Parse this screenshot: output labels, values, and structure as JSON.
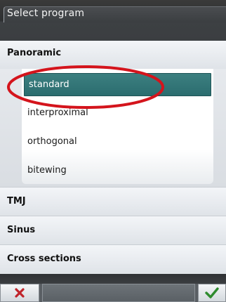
{
  "window": {
    "title": "Select program"
  },
  "groups": [
    {
      "label": "Panoramic",
      "expanded": true
    },
    {
      "label": "TMJ",
      "expanded": false
    },
    {
      "label": "Sinus",
      "expanded": false
    },
    {
      "label": "Cross sections",
      "expanded": false
    }
  ],
  "panoramic_programs": [
    {
      "label": "standard",
      "selected": true
    },
    {
      "label": "interproximal",
      "selected": false
    },
    {
      "label": "orthogonal",
      "selected": false
    },
    {
      "label": "bitewing",
      "selected": false
    }
  ],
  "footer": {
    "cancel_icon": "close-icon",
    "ok_icon": "checkmark-icon",
    "cancel_color": "#c0242b",
    "ok_color": "#2e8b2e"
  },
  "colors": {
    "selection": "#2f7274",
    "annotation": "#d4141c"
  }
}
